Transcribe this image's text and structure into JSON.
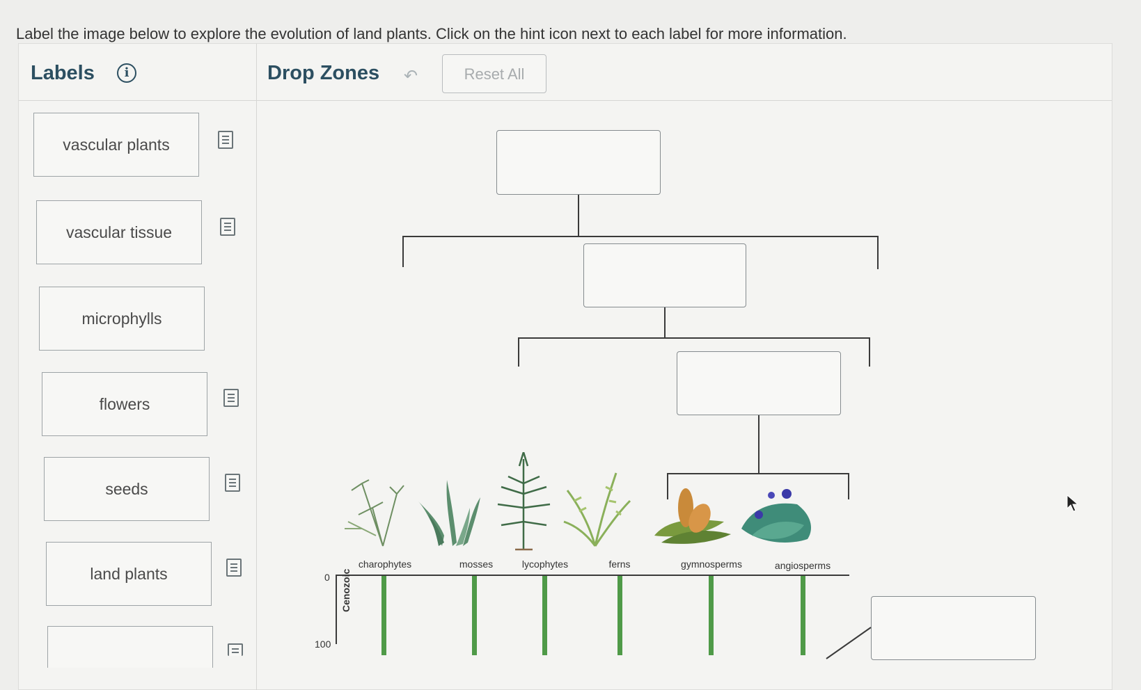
{
  "instructions": "Label the image below to explore the evolution of land plants. Click on the hint icon next to each label for more information.",
  "labels_panel": {
    "title": "Labels",
    "info_icon": "info-circle-icon"
  },
  "drop_zones_panel": {
    "title": "Drop Zones",
    "undo_icon": "undo-arrow-icon",
    "reset_label": "Reset All"
  },
  "labels": [
    {
      "text": "vascular plants",
      "hint_icon": "document-hint-icon"
    },
    {
      "text": "vascular tissue",
      "hint_icon": "document-hint-icon"
    },
    {
      "text": "microphylls",
      "hint_icon": ""
    },
    {
      "text": "flowers",
      "hint_icon": "document-hint-icon"
    },
    {
      "text": "seeds",
      "hint_icon": "document-hint-icon"
    },
    {
      "text": "land plants",
      "hint_icon": "document-hint-icon"
    },
    {
      "text": "",
      "hint_icon": "document-hint-icon"
    }
  ],
  "diagram": {
    "plants": [
      "charophytes",
      "mosses",
      "lycophytes",
      "ferns",
      "gymnosperms",
      "angiosperms"
    ],
    "axis": {
      "top_tick": "0",
      "bottom_tick": "100",
      "era": "Cenozoic"
    }
  },
  "colors": {
    "heading": "#2c4f61",
    "timeline_bar": "#4f9a48"
  }
}
